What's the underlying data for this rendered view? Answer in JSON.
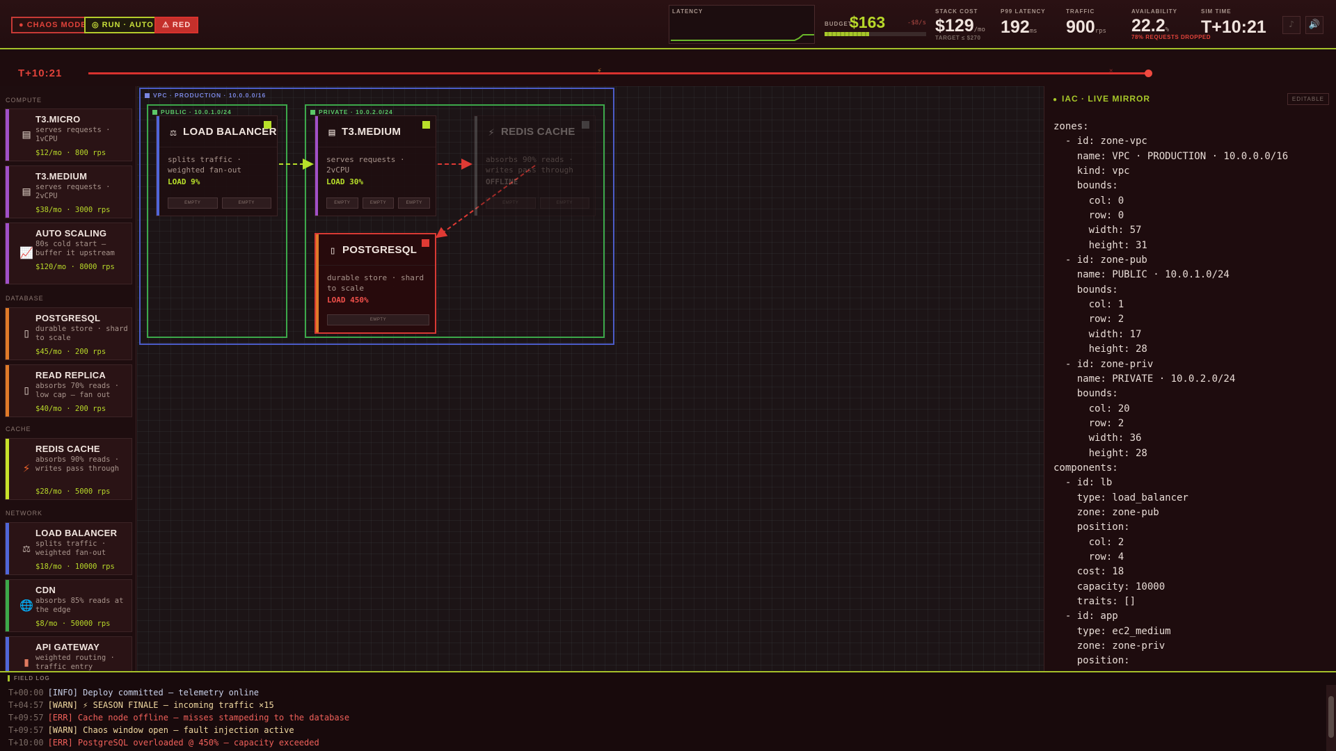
{
  "topbar": {
    "chaos_mode": "● CHAOS MODE",
    "run_auto": "◎ RUN · AUTO",
    "red": "⚠ RED",
    "latency_label": "LATENCY",
    "budget_label": "BUDGET",
    "budget_value": "$163",
    "budget_rate": "-$8/s",
    "budget_fraction": 0.44,
    "stack_cost_label": "STACK COST",
    "stack_cost_value": "$129",
    "stack_cost_unit": "/mo",
    "stack_cost_target": "TARGET ≤ $270",
    "p99_label": "P99 LATENCY",
    "p99_value": "192",
    "p99_unit": "ms",
    "traffic_label": "TRAFFIC",
    "traffic_value": "900",
    "traffic_unit": "rps",
    "availability_label": "AVAILABILITY",
    "availability_value": "22.2",
    "availability_unit": "%",
    "availability_sub": "78% REQUESTS DROPPED",
    "sim_time_label": "SIM TIME",
    "sim_time_value": "T+10:21",
    "music_icon": "♪",
    "sound_icon": "🔊",
    "colors": {
      "accent": "#a6c12a",
      "danger": "#d8322e"
    }
  },
  "timeline": {
    "time": "T+10:21",
    "marker_icon": "⚡",
    "marker2_icon": "✕",
    "progress": 0.98
  },
  "palette": {
    "categories": {
      "compute": "COMPUTE",
      "database": "DATABASE",
      "cache": "CACHE",
      "network": "NETWORK"
    },
    "items": [
      {
        "title": "T3.MICRO",
        "desc": "serves requests · 1vCPU",
        "price": "$12/mo · 800 rps",
        "icon": "▤",
        "color": "#a050c8"
      },
      {
        "title": "T3.MEDIUM",
        "desc": "serves requests · 2vCPU",
        "price": "$38/mo · 3000 rps",
        "icon": "▤",
        "color": "#a050c8"
      },
      {
        "title": "AUTO SCALING",
        "desc": "80s cold start — buffer it upstream",
        "price": "$120/mo · 8000 rps",
        "icon": "📈",
        "color": "#a050c8"
      },
      {
        "title": "POSTGRESQL",
        "desc": "durable store · shard to scale",
        "price": "$45/mo · 200 rps",
        "icon": "▯",
        "color": "#e07a28"
      },
      {
        "title": "READ REPLICA",
        "desc": "absorbs 70% reads · low cap — fan out",
        "price": "$40/mo · 200 rps",
        "icon": "▯",
        "color": "#e07a28"
      },
      {
        "title": "REDIS CACHE",
        "desc": "absorbs 90% reads · writes pass through",
        "price": "$28/mo · 5000 rps",
        "icon": "⚡",
        "color": "#c8e02a"
      },
      {
        "title": "LOAD BALANCER",
        "desc": "splits traffic · weighted fan-out",
        "price": "$18/mo · 10000 rps",
        "icon": "⚖",
        "color": "#5066d8"
      },
      {
        "title": "CDN",
        "desc": "absorbs 85% reads at the edge",
        "price": "$8/mo · 50000 rps",
        "icon": "🌐",
        "color": "#3ca84a"
      },
      {
        "title": "API GATEWAY",
        "desc": "weighted routing · traffic entry",
        "price": "",
        "icon": "▮",
        "color": "#5066d8"
      }
    ]
  },
  "canvas": {
    "zones": {
      "vpc": "VPC · PRODUCTION · 10.0.0.0/16",
      "pub": "PUBLIC · 10.0.1.0/24",
      "priv": "PRIVATE · 10.0.2.0/24"
    },
    "components": {
      "lb": {
        "title": "LOAD BALANCER",
        "desc": "splits traffic · weighted fan-out",
        "load": "LOAD 9%",
        "icon": "⚖",
        "color": "#5066d8",
        "status": "#b8e02a",
        "slots": [
          "EMPTY",
          "EMPTY"
        ]
      },
      "app": {
        "title": "T3.MEDIUM",
        "desc": "serves requests · 2vCPU",
        "load": "LOAD 30%",
        "icon": "▤",
        "color": "#a050c8",
        "status": "#b8e02a",
        "slots": [
          "EMPTY",
          "EMPTY",
          "EMPTY"
        ]
      },
      "redis": {
        "title": "REDIS CACHE",
        "desc": "absorbs 90% reads · writes pass through",
        "load": "OFFLINE",
        "icon": "⚡",
        "color": "#8a8a8a",
        "status": "#8a8a8a",
        "slots": [
          "EMPTY",
          "EMPTY"
        ]
      },
      "pg": {
        "title": "POSTGRESQL",
        "desc": "durable store · shard to scale",
        "load": "LOAD 450%",
        "icon": "▯",
        "color": "#e07a28",
        "status": "#e03a34",
        "slots": [
          "EMPTY"
        ]
      }
    }
  },
  "iac": {
    "title": "IAC · LIVE MIRROR",
    "editable": "EDITABLE",
    "code": "zones:\n  - id: zone-vpc\n    name: VPC · PRODUCTION · 10.0.0.0/16\n    kind: vpc\n    bounds:\n      col: 0\n      row: 0\n      width: 57\n      height: 31\n  - id: zone-pub\n    name: PUBLIC · 10.0.1.0/24\n    bounds:\n      col: 1\n      row: 2\n      width: 17\n      height: 28\n  - id: zone-priv\n    name: PRIVATE · 10.0.2.0/24\n    bounds:\n      col: 20\n      row: 2\n      width: 36\n      height: 28\ncomponents:\n  - id: lb\n    type: load_balancer\n    zone: zone-pub\n    position:\n      col: 2\n      row: 4\n    cost: 18\n    capacity: 10000\n    traits: []\n  - id: app\n    type: ec2_medium\n    zone: zone-priv\n    position:"
  },
  "log": {
    "title": "FIELD LOG",
    "lines": [
      {
        "time": "T+00:00",
        "text": "[INFO] Deploy committed — telemetry online",
        "level": "info"
      },
      {
        "time": "T+04:57",
        "text": "[WARN] ⚡ SEASON FINALE — incoming traffic ×15",
        "level": "warn"
      },
      {
        "time": "T+09:57",
        "text": "[ERR] Cache node offline — misses stampeding to the database",
        "level": "err"
      },
      {
        "time": "T+09:57",
        "text": "[WARN] Chaos window open — fault injection active",
        "level": "warn"
      },
      {
        "time": "T+10:00",
        "text": "[ERR] PostgreSQL overloaded @ 450% — capacity exceeded",
        "level": "err"
      }
    ]
  }
}
